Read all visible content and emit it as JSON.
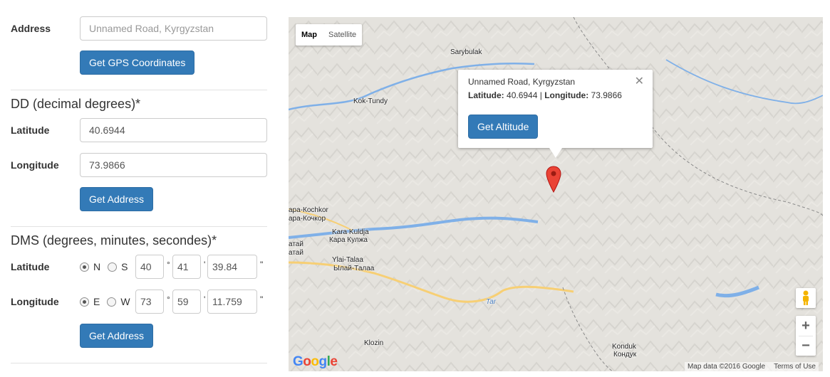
{
  "address_section": {
    "label": "Address",
    "value": "",
    "placeholder": "Unnamed Road, Kyrgyzstan",
    "button": "Get GPS Coordinates"
  },
  "dd_section": {
    "heading": "DD (decimal degrees)*",
    "lat_label": "Latitude",
    "lat_value": "40.6944",
    "lng_label": "Longitude",
    "lng_value": "73.9866",
    "button": "Get Address"
  },
  "dms_section": {
    "heading": "DMS (degrees, minutes, secondes)*",
    "lat_label": "Latitude",
    "lat_dir_a": "N",
    "lat_dir_b": "S",
    "lat_deg": "40",
    "lat_min": "41",
    "lat_sec": "39.84",
    "lng_label": "Longitude",
    "lng_dir_a": "E",
    "lng_dir_b": "W",
    "lng_deg": "73",
    "lng_min": "59",
    "lng_sec": "11.759",
    "deg_sym": "°",
    "min_sym": "'",
    "sec_sym": "\"",
    "button": "Get Address"
  },
  "map": {
    "type_map": "Map",
    "type_satellite": "Satellite",
    "places": {
      "sarybulak": "Sarybulak",
      "koktundy": "Kok-Tundy",
      "kochkor1": "ара-Кochkor",
      "kochkor2": "ара-Кочкор",
      "karakuldja1": "Kara Kuldja",
      "karakuldja2": "Кара Кулжа",
      "atai1": "атай",
      "atai2": "атай",
      "ylaitalaa1": "Ylai-Talaa",
      "ylaitalaa2": "Ылай-Талаа",
      "tar": "Tar",
      "kozin": "Klozin",
      "konduk1": "Konduk",
      "konduk2": "Кондук"
    },
    "infowindow": {
      "title": "Unnamed Road, Kyrgyzstan",
      "lat_label": "Latitude:",
      "lat_value": "40.6944",
      "separator": "|",
      "lng_label": "Longitude:",
      "lng_value": "73.9866",
      "button": "Get Altitude",
      "close": "✕"
    },
    "zoom_in": "+",
    "zoom_out": "−",
    "logo": "Google",
    "map_data": "Map data ©2016 Google",
    "terms": "Terms of Use",
    "colors": {
      "road": "#f7cf74",
      "river": "#7fb0e8",
      "marker": "#ea4335",
      "button": "#337ab7"
    }
  }
}
